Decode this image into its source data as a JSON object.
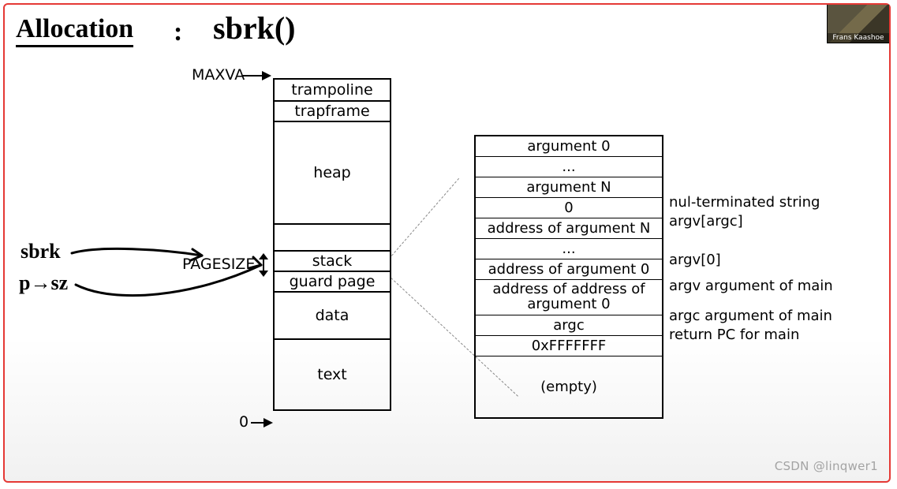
{
  "title_hand": "Allocation",
  "colon": ":",
  "sbrk_big": "sbrk()",
  "sbrk_note": "sbrk",
  "psz_note": "p→sz",
  "labels": {
    "maxva": "MAXVA",
    "pagesize": "PAGESIZE",
    "zero": "0"
  },
  "mem": {
    "trampoline": "trampoline",
    "trapframe": "trapframe",
    "heap": "heap",
    "stack": "stack",
    "guard": "guard page",
    "data": "data",
    "text": "text"
  },
  "stack_rows": {
    "arg0": "argument 0",
    "dots1": "...",
    "argN": "argument N",
    "zero": "0",
    "addrN": "address of argument N",
    "dots2": "...",
    "addr0": "address of argument 0",
    "addraddr1": "address of address of",
    "addraddr2": "argument 0",
    "argc": "argc",
    "retpc": "0xFFFFFFF",
    "empty": "(empty)"
  },
  "notes": {
    "nul": "nul-terminated string",
    "argvN": "argv[argc]",
    "argv0": "argv[0]",
    "argv": "argv argument of main",
    "argc": "argc argument of main",
    "retpc": "return PC for main"
  },
  "thumb_caption": "Frans Kaashoe",
  "watermark": "CSDN @linqwer1"
}
